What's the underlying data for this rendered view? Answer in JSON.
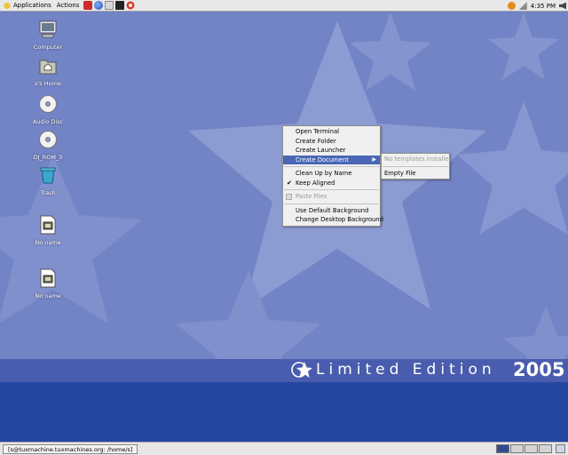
{
  "top_panel": {
    "menus": [
      "Applications",
      "Actions"
    ],
    "launchers": [
      "red-hat-icon",
      "globe-icon",
      "mail-icon",
      "terminal-icon",
      "lifesaver-icon"
    ],
    "clock": "4:35 PM"
  },
  "desktop": {
    "icons": [
      {
        "label": "Computer",
        "icon": "computer-icon"
      },
      {
        "label": "s's Home",
        "icon": "home-folder-icon"
      },
      {
        "label": "Audio Disc",
        "icon": "cd-icon"
      },
      {
        "label": "DJ_ROM_3",
        "icon": "cd-icon"
      },
      {
        "label": "Trash",
        "icon": "trash-icon"
      },
      {
        "label": "No name",
        "icon": "film-icon"
      },
      {
        "label": "No name",
        "icon": "film-icon"
      }
    ]
  },
  "context_menu": {
    "items": [
      "Open Terminal",
      "Create Folder",
      "Create Launcher",
      "Create Document",
      "Clean Up by Name",
      "Keep Aligned",
      "Paste Files",
      "Use Default Background",
      "Change Desktop Background"
    ],
    "submenu": [
      "No templates installed",
      "Empty File"
    ]
  },
  "branding": {
    "text": "Limited Edition",
    "year": "2005"
  },
  "bottom_panel": {
    "task": "[s@tuxmachine.tuxmachines.org: /home/s]"
  },
  "colors": {
    "desktop": "#7384c6",
    "band": "#2447a4",
    "menu_highlight": "#4a67b6"
  }
}
